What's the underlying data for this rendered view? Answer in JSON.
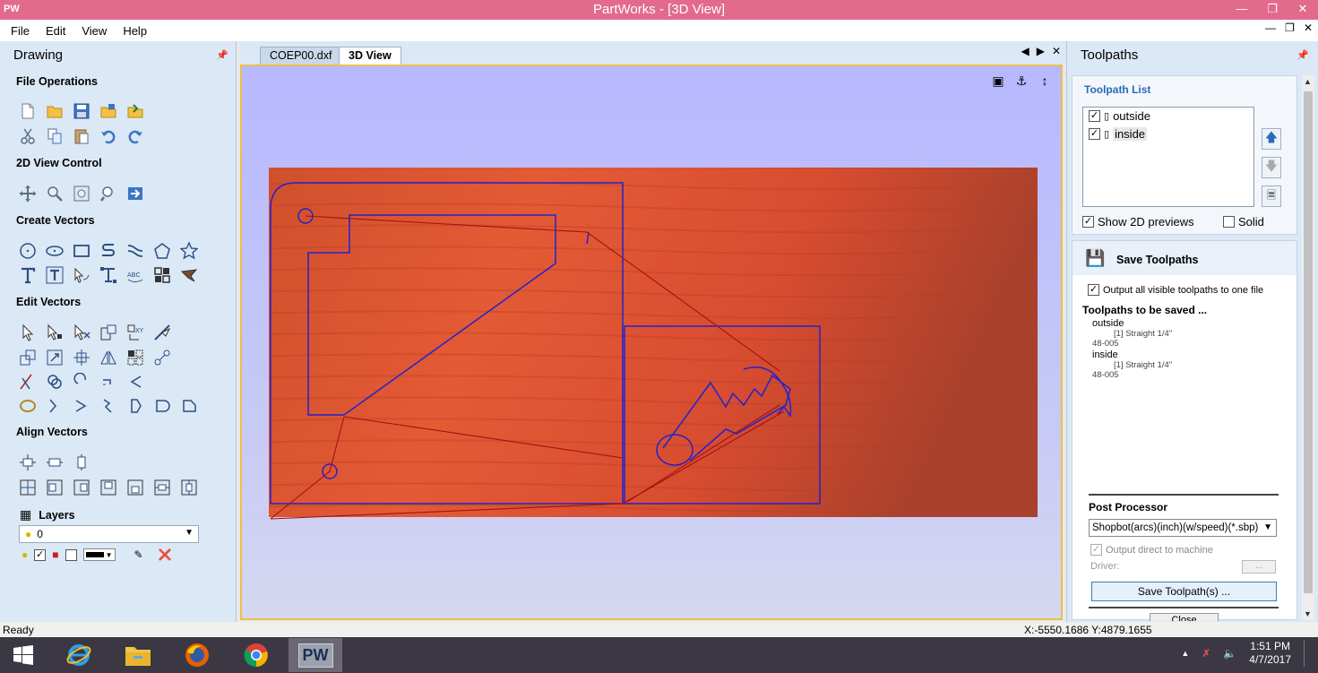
{
  "window": {
    "app_icon": "PW",
    "title": "PartWorks - [3D View]",
    "controls": [
      "minimize-icon",
      "restore-icon",
      "close-icon"
    ]
  },
  "menu": {
    "items": [
      "File",
      "Edit",
      "View",
      "Help"
    ]
  },
  "left_panel": {
    "title": "Drawing",
    "sections": {
      "file_ops": "File Operations",
      "view_2d": "2D View Control",
      "create": "Create Vectors",
      "edit": "Edit Vectors",
      "align": "Align Vectors"
    },
    "layers": {
      "title": "Layers",
      "selected": "0"
    }
  },
  "tabs": [
    {
      "label": "COEP00.dxf",
      "active": false
    },
    {
      "label": "3D View",
      "active": true
    }
  ],
  "right_panel": {
    "title": "Toolpaths",
    "toolpath_list_title": "Toolpath List",
    "toolpaths": [
      {
        "name": "outside",
        "checked": true
      },
      {
        "name": "inside",
        "checked": true
      }
    ],
    "show_2d_previews_label": "Show 2D previews",
    "show_2d_previews": true,
    "solid_label": "Solid",
    "solid": false,
    "save": {
      "title": "Save Toolpaths",
      "output_all_label": "Output all visible toolpaths to one file",
      "output_all": true,
      "to_be_saved_title": "Toolpaths to be saved ...",
      "items": [
        {
          "name": "outside",
          "tool": "[1] Straight 1/4\"",
          "code": "48-005"
        },
        {
          "name": "inside",
          "tool": "[1] Straight 1/4\"",
          "code": "48-005"
        }
      ],
      "post_processor_title": "Post Processor",
      "post_processor": "Shopbot(arcs)(inch)(w/speed)(*.sbp)",
      "output_direct_label": "Output direct to machine",
      "driver_label": "Driver:",
      "driver_button": "...",
      "save_button": "Save Toolpath(s) ...",
      "close_button": "Close"
    }
  },
  "status": {
    "left": "Ready",
    "coords": "X:-5550.1686 Y:4879.1655"
  },
  "taskbar": {
    "apps": [
      "windows-start-icon",
      "internet-explorer-icon",
      "file-explorer-icon",
      "firefox-icon",
      "chrome-icon",
      "partworks-icon"
    ],
    "active_app_label": "PW",
    "time": "1:51 PM",
    "date": "4/7/2017"
  },
  "colors": {
    "titlebar": "#e26a8c",
    "panel": "#dbe8f5",
    "viewport_border": "#e8c14a",
    "toolpath_blue": "#2222cc",
    "toolpath_red": "#aa1010",
    "accent_blue": "#2a6bb8"
  }
}
